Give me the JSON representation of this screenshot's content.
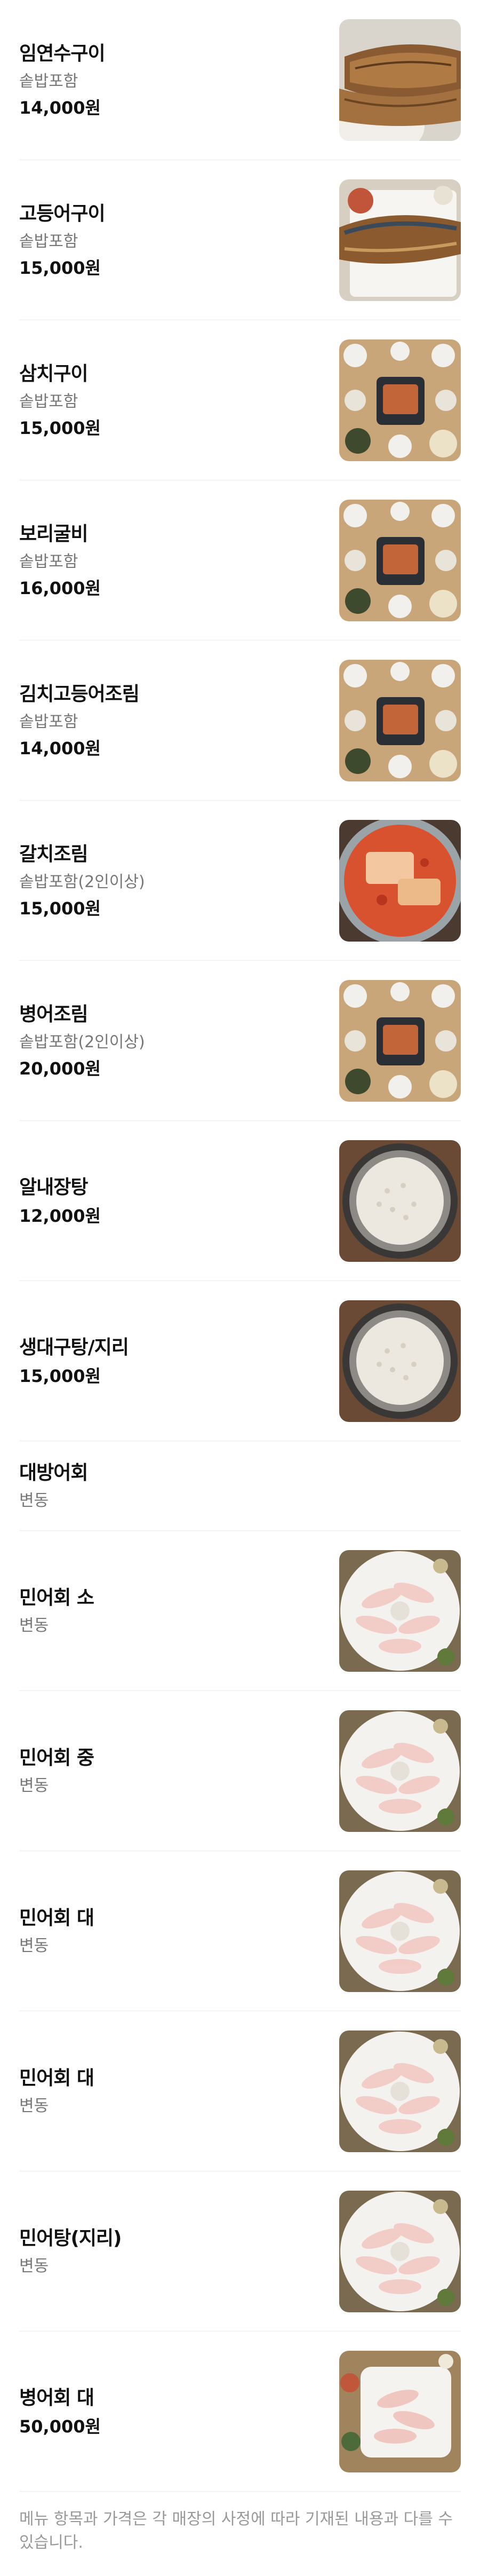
{
  "menu_items": [
    {
      "name": "임연수구이",
      "desc": "솥밥포함",
      "price": "14,000원",
      "image": "grilled-fish"
    },
    {
      "name": "고등어구이",
      "desc": "솥밥포함",
      "price": "15,000원",
      "image": "grilled-mackerel"
    },
    {
      "name": "삼치구이",
      "desc": "솥밥포함",
      "price": "15,000원",
      "image": "table-set"
    },
    {
      "name": "보리굴비",
      "desc": "솥밥포함",
      "price": "16,000원",
      "image": "table-set"
    },
    {
      "name": "김치고등어조림",
      "desc": "솥밥포함",
      "price": "14,000원",
      "image": "table-set"
    },
    {
      "name": "갈치조림",
      "desc": "솥밥포함(2인이상)",
      "price": "15,000원",
      "image": "braised-cutlassfish"
    },
    {
      "name": "병어조림",
      "desc": "솥밥포함(2인이상)",
      "price": "20,000원",
      "image": "table-set"
    },
    {
      "name": "알내장탕",
      "desc": "",
      "price": "12,000원",
      "image": "pot-rice"
    },
    {
      "name": "생대구탕/지리",
      "desc": "",
      "price": "15,000원",
      "image": "pot-rice"
    },
    {
      "name": "대방어회",
      "desc": "변동",
      "price": "",
      "image": ""
    },
    {
      "name": "민어회 소",
      "desc": "변동",
      "price": "",
      "image": "sashimi-plate"
    },
    {
      "name": "민어회 중",
      "desc": "변동",
      "price": "",
      "image": "sashimi-plate"
    },
    {
      "name": "민어회 대",
      "desc": "변동",
      "price": "",
      "image": "sashimi-plate"
    },
    {
      "name": "민어회 대",
      "desc": "변동",
      "price": "",
      "image": "sashimi-plate"
    },
    {
      "name": "민어탕(지리)",
      "desc": "변동",
      "price": "",
      "image": "sashimi-plate"
    },
    {
      "name": "병어회 대",
      "desc": "",
      "price": "50,000원",
      "image": "sashimi-side"
    }
  ],
  "notice": "메뉴 항목과 가격은 각 매장의 사정에 따라 기재된 내용과 다를 수 있습니다."
}
